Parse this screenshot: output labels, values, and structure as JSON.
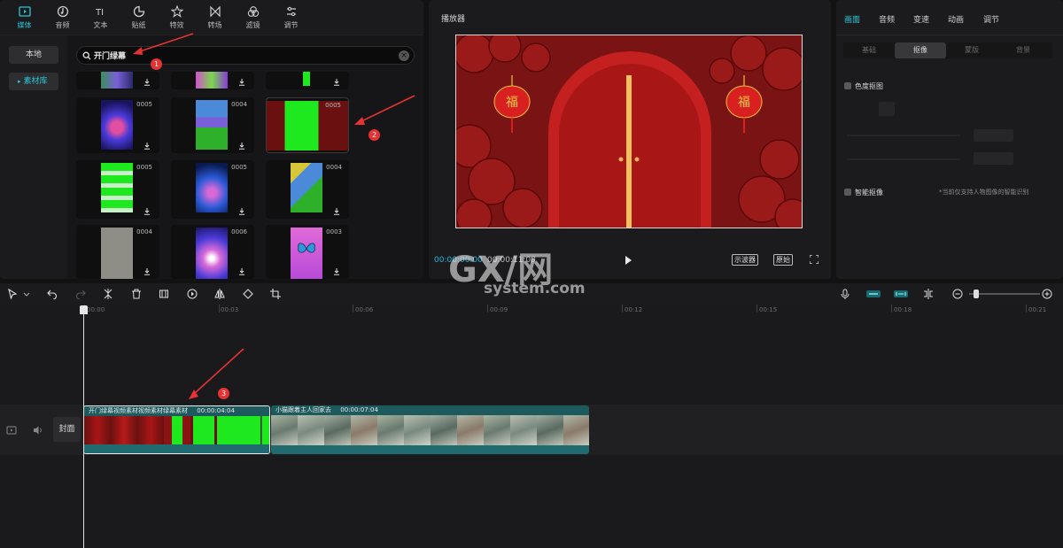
{
  "toolbar": {
    "tools": [
      {
        "label": "媒体",
        "icon": "media-icon",
        "active": true
      },
      {
        "label": "音频",
        "icon": "audio-icon"
      },
      {
        "label": "文本",
        "icon": "text-icon"
      },
      {
        "label": "贴纸",
        "icon": "sticker-icon"
      },
      {
        "label": "特效",
        "icon": "effects-icon"
      },
      {
        "label": "转场",
        "icon": "transition-icon"
      },
      {
        "label": "滤镜",
        "icon": "filter-icon"
      },
      {
        "label": "调节",
        "icon": "adjust-icon"
      }
    ]
  },
  "sidebar": {
    "local_label": "本地",
    "library_label": "素材库"
  },
  "search": {
    "value": "开门绿幕"
  },
  "media_cards": [
    {
      "duration": "0005"
    },
    {
      "duration": "0004"
    },
    {
      "duration": "0005"
    },
    {
      "duration": "0005"
    },
    {
      "duration": "0005"
    },
    {
      "duration": "0004"
    },
    {
      "duration": "0004"
    },
    {
      "duration": "0006"
    },
    {
      "duration": "0003"
    }
  ],
  "player": {
    "title": "播放器",
    "current_time": "00:00:00:00",
    "total_time": "00:00:11:08",
    "scope_label": "示波器",
    "original_label": "原始"
  },
  "right_panel": {
    "tabs": [
      "画面",
      "音频",
      "变速",
      "动画",
      "调节"
    ],
    "sub_tabs": [
      "基础",
      "抠像",
      "蒙版",
      "背景"
    ],
    "chroma_label": "色度抠图",
    "smart_label": "智能抠像",
    "smart_hint": "*当前仅支持人物图像的智能识别"
  },
  "timeline": {
    "ticks": [
      "00:00",
      "00:03",
      "00:06",
      "00:09",
      "00:12",
      "00:15",
      "00:18",
      "00:21"
    ],
    "cover_label": "封面",
    "clip1_label": "开门绿幕视频素材视频素材绿幕素材",
    "clip1_duration": "00:00:04:04",
    "clip2_label": "小猫跟着主人回家去",
    "clip2_duration": "00:00:07:04"
  },
  "annotations": [
    "1",
    "2",
    "3"
  ],
  "watermark": {
    "brand": "GX/网",
    "site": "system.com"
  },
  "colors": {
    "accent": "#27c8d8",
    "annotation_red": "#e53333",
    "green_screen": "#1ee81e",
    "clip_header": "#1d5a5e"
  }
}
